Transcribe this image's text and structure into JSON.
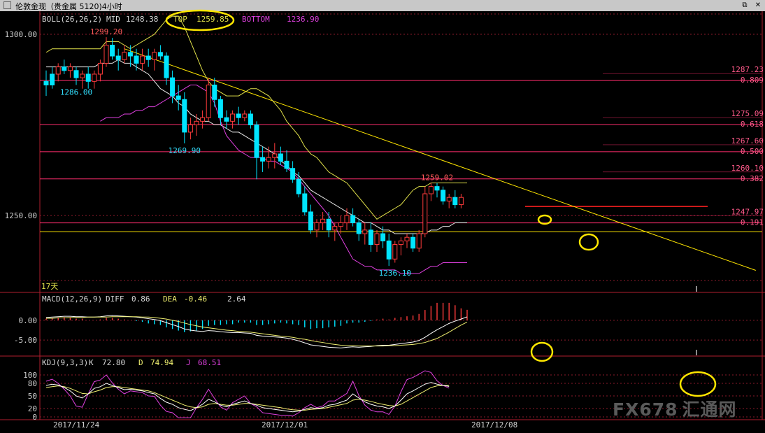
{
  "window": {
    "title": "伦敦金现（贵金属 5120)4小时"
  },
  "watermark": {
    "brand": "FX678",
    "cn": "汇通网"
  },
  "colors": {
    "bg": "#000000",
    "up": "#ff3b3b",
    "down": "#00e5ff",
    "mid": "#e8e8e8",
    "top": "#e0e04a",
    "bottom": "#e040e0",
    "hline": "#ff2e6e",
    "yellow": "#ffe600",
    "dea": "#f0f070",
    "diff": "#ffffff",
    "k": "#ffffff",
    "d": "#f0f070",
    "j": "#e040e0",
    "grid": "#8a1a2a"
  },
  "chart_data": [
    {
      "type": "candlestick",
      "indicator": {
        "name": "BOLL(26,26,2)",
        "mid_label": "MID",
        "mid": "1248.38",
        "top_label": "TOP",
        "top": "1259.85",
        "bottom_label": "BOTTOM",
        "bottom": "1236.90"
      },
      "y_ticks": [
        "1300.00",
        "1250.00"
      ],
      "ylim": [
        1231.5,
        1302.5
      ],
      "x_ticks": [
        "2017/11/24",
        "2017/12/01",
        "2017/12/08"
      ],
      "period_label": "17天",
      "annotations": [
        {
          "text": "1299.20",
          "i": 10,
          "price": 1299.2,
          "color": "up"
        },
        {
          "text": "1286.00",
          "i": 5,
          "price": 1286.0,
          "color": "down"
        },
        {
          "text": "1269.90",
          "i": 23,
          "price": 1269.9,
          "color": "down"
        },
        {
          "text": "1236.10",
          "i": 58,
          "price": 1236.1,
          "color": "down"
        },
        {
          "text": "1259.02",
          "i": 65,
          "price": 1259.02,
          "color": "up"
        }
      ],
      "fib_levels": [
        {
          "price": "1287.23",
          "ratio": "0.809"
        },
        {
          "price": "1275.09",
          "ratio": "0.618"
        },
        {
          "price": "1267.60",
          "ratio": "0.500"
        },
        {
          "price": "1260.10",
          "ratio": "0.382"
        },
        {
          "price": "1247.97",
          "ratio": "0.191"
        }
      ],
      "candles": [
        [
          1287,
          1290,
          1283,
          1286
        ],
        [
          1289,
          1291,
          1285,
          1286
        ],
        [
          1289,
          1292,
          1287,
          1291
        ],
        [
          1291,
          1293,
          1289,
          1290
        ],
        [
          1290,
          1292,
          1288,
          1291
        ],
        [
          1290,
          1291,
          1286,
          1288
        ],
        [
          1288,
          1290,
          1285,
          1289
        ],
        [
          1289,
          1291,
          1285,
          1287
        ],
        [
          1287,
          1290,
          1285,
          1289
        ],
        [
          1289,
          1293,
          1287,
          1292
        ],
        [
          1292,
          1299.2,
          1291,
          1297
        ],
        [
          1297,
          1299,
          1293,
          1294
        ],
        [
          1294,
          1296,
          1290,
          1293
        ],
        [
          1293,
          1297,
          1292,
          1295
        ],
        [
          1295,
          1297,
          1291,
          1294
        ],
        [
          1294,
          1296,
          1290,
          1292
        ],
        [
          1292,
          1296,
          1290,
          1294
        ],
        [
          1294,
          1296,
          1291,
          1293
        ],
        [
          1293,
          1296,
          1290,
          1295
        ],
        [
          1295,
          1297,
          1293,
          1294
        ],
        [
          1294,
          1295,
          1286,
          1288
        ],
        [
          1288,
          1290,
          1281,
          1283
        ],
        [
          1283,
          1286,
          1279,
          1282
        ],
        [
          1282,
          1284,
          1269.9,
          1273
        ],
        [
          1273,
          1277,
          1271,
          1275
        ],
        [
          1275,
          1278,
          1272,
          1276
        ],
        [
          1276,
          1279,
          1274,
          1277
        ],
        [
          1277,
          1288,
          1276,
          1286
        ],
        [
          1286,
          1288,
          1280,
          1282
        ],
        [
          1282,
          1283,
          1275,
          1277
        ],
        [
          1277,
          1279,
          1274,
          1276
        ],
        [
          1276,
          1279,
          1274,
          1278
        ],
        [
          1278,
          1280,
          1275,
          1277
        ],
        [
          1277,
          1279,
          1276,
          1278
        ],
        [
          1278,
          1279,
          1274,
          1275
        ],
        [
          1275,
          1276,
          1260,
          1266
        ],
        [
          1266,
          1269,
          1262,
          1265
        ],
        [
          1265,
          1269,
          1263,
          1266
        ],
        [
          1266,
          1270,
          1263,
          1267
        ],
        [
          1267,
          1269,
          1264,
          1265
        ],
        [
          1265,
          1268,
          1262,
          1263
        ],
        [
          1263,
          1265,
          1259,
          1260
        ],
        [
          1260,
          1262,
          1255,
          1256
        ],
        [
          1256,
          1258,
          1250,
          1251
        ],
        [
          1251,
          1253,
          1245,
          1246
        ],
        [
          1246,
          1249,
          1244,
          1248
        ],
        [
          1248,
          1251,
          1246,
          1249
        ],
        [
          1249,
          1251,
          1244,
          1246
        ],
        [
          1246,
          1248,
          1243,
          1247
        ],
        [
          1247,
          1250,
          1245,
          1248
        ],
        [
          1248,
          1252,
          1246,
          1250
        ],
        [
          1250,
          1252,
          1247,
          1248
        ],
        [
          1248,
          1249,
          1243,
          1245
        ],
        [
          1245,
          1248,
          1242,
          1246
        ],
        [
          1246,
          1248,
          1240,
          1242
        ],
        [
          1242,
          1246,
          1240,
          1245
        ],
        [
          1245,
          1247,
          1241,
          1243
        ],
        [
          1243,
          1245,
          1236.1,
          1238
        ],
        [
          1238,
          1243,
          1237,
          1242
        ],
        [
          1242,
          1244,
          1239,
          1243
        ],
        [
          1243,
          1245,
          1241,
          1244
        ],
        [
          1244,
          1245,
          1240,
          1241
        ],
        [
          1241,
          1246,
          1240,
          1245
        ],
        [
          1245,
          1258,
          1244,
          1256
        ],
        [
          1256,
          1259.02,
          1254,
          1258
        ],
        [
          1258,
          1259,
          1255,
          1257
        ],
        [
          1257,
          1258,
          1253,
          1254
        ],
        [
          1254,
          1256,
          1252,
          1255
        ],
        [
          1255,
          1257,
          1252,
          1253
        ],
        [
          1253,
          1256,
          1252,
          1255
        ]
      ],
      "mid": [
        1291,
        1291,
        1291,
        1291,
        1291,
        1291,
        1291,
        1291,
        1291,
        1292,
        1292,
        1292,
        1293,
        1292,
        1292,
        1291,
        1290,
        1289,
        1287,
        1285,
        1284,
        1283,
        1281,
        1280,
        1278,
        1277,
        1276,
        1276,
        1275,
        1275,
        1274,
        1273,
        1273,
        1272,
        1271,
        1270,
        1269,
        1268,
        1267,
        1265,
        1264,
        1262,
        1261,
        1259,
        1257,
        1256,
        1255,
        1254,
        1253,
        1252,
        1251,
        1250,
        1249,
        1248,
        1248,
        1247,
        1246,
        1246,
        1245,
        1245,
        1245,
        1245,
        1245,
        1245,
        1246,
        1246,
        1247,
        1247,
        1248,
        1248,
        1248
      ],
      "top": [
        1295,
        1296,
        1296,
        1296,
        1296,
        1296,
        1296,
        1296,
        1296,
        1296,
        1298,
        1298,
        1298,
        1297,
        1296,
        1297,
        1298,
        1299,
        1300,
        1302,
        1304,
        1305,
        1305,
        1302,
        1298,
        1294,
        1290,
        1287,
        1285,
        1284,
        1283,
        1283,
        1283,
        1284,
        1285,
        1285,
        1284,
        1283,
        1281,
        1279,
        1276,
        1274,
        1272,
        1269,
        1267,
        1266,
        1264,
        1262,
        1261,
        1260,
        1259,
        1257,
        1255,
        1253,
        1251,
        1249,
        1250,
        1251,
        1252,
        1253,
        1255,
        1257,
        1258,
        1258,
        1259,
        1259,
        1259,
        1259,
        1259,
        1259,
        1259
      ],
      "bottom": [
        1276,
        1277,
        1277,
        1277,
        1278,
        1278,
        1279,
        1279,
        1280,
        1280,
        1281,
        1282,
        1283,
        1284,
        1285,
        1286,
        1286,
        1285,
        1284,
        1281,
        1276,
        1272,
        1270,
        1268,
        1267,
        1266,
        1266,
        1266,
        1265,
        1265,
        1264,
        1263,
        1262,
        1260,
        1258,
        1256,
        1254,
        1252,
        1250,
        1247,
        1244,
        1241,
        1238,
        1237,
        1236,
        1236,
        1235,
        1235,
        1235,
        1235,
        1234,
        1234,
        1234,
        1234,
        1235,
        1236,
        1236,
        1237,
        1237,
        1237,
        1237,
        1237
      ],
      "bottom_start": 9,
      "trendline": {
        "from": [
          13,
          1296
        ],
        "to": [
          80,
          1257
        ]
      },
      "support_line": 1245.5,
      "resistance_line": 1252.5
    },
    {
      "type": "bar",
      "indicator": {
        "name": "MACD(12,26,9)",
        "diff_label": "DIFF",
        "diff": "0.86",
        "dea_label": "DEA",
        "dea": "-0.46",
        "macd": "2.64"
      },
      "y_ticks": [
        "0.00",
        "-5.00"
      ],
      "ylim": [
        -8.5,
        3.5
      ],
      "diff": [
        0.7,
        0.8,
        0.9,
        1.0,
        1.0,
        0.9,
        0.9,
        0.8,
        0.8,
        0.9,
        1.1,
        1.2,
        1.1,
        1.0,
        0.9,
        0.8,
        0.6,
        0.4,
        0.2,
        -0.1,
        -0.6,
        -1.1,
        -1.6,
        -2.2,
        -2.5,
        -2.7,
        -2.8,
        -2.6,
        -2.7,
        -2.9,
        -3.0,
        -3.1,
        -3.1,
        -3.2,
        -3.3,
        -3.8,
        -4.0,
        -4.1,
        -4.2,
        -4.3,
        -4.5,
        -4.8,
        -5.2,
        -5.7,
        -6.2,
        -6.4,
        -6.6,
        -6.8,
        -6.9,
        -7.0,
        -6.8,
        -6.7,
        -6.8,
        -6.7,
        -6.6,
        -6.4,
        -6.3,
        -6.3,
        -6.1,
        -5.9,
        -5.7,
        -5.5,
        -5.1,
        -4.3,
        -3.3,
        -2.4,
        -1.6,
        -0.8,
        -0.2,
        0.3,
        0.86
      ],
      "dea": [
        0.5,
        0.5,
        0.6,
        0.6,
        0.7,
        0.7,
        0.7,
        0.8,
        0.8,
        0.8,
        0.8,
        0.9,
        0.9,
        0.9,
        0.9,
        0.9,
        0.8,
        0.8,
        0.7,
        0.5,
        0.3,
        0.0,
        -0.3,
        -0.7,
        -1.1,
        -1.4,
        -1.7,
        -1.9,
        -2.1,
        -2.3,
        -2.5,
        -2.6,
        -2.8,
        -2.9,
        -3.0,
        -3.2,
        -3.4,
        -3.6,
        -3.8,
        -4.0,
        -4.1,
        -4.3,
        -4.6,
        -4.8,
        -5.1,
        -5.4,
        -5.6,
        -5.9,
        -6.1,
        -6.3,
        -6.4,
        -6.4,
        -6.5,
        -6.5,
        -6.5,
        -6.5,
        -6.5,
        -6.4,
        -6.4,
        -6.3,
        -6.2,
        -6.1,
        -5.9,
        -5.6,
        -5.1,
        -4.6,
        -3.8,
        -3.0,
        -2.1,
        -1.2,
        -0.46
      ]
    },
    {
      "type": "line",
      "indicator": {
        "name": "KDJ(9,3,3)",
        "k_label": "K",
        "k": "72.80",
        "d_label": "D",
        "d": "74.94",
        "j_label": "J",
        "j": "68.51"
      },
      "y_ticks": [
        "100",
        "80",
        "50",
        "20",
        "0"
      ],
      "ylim": [
        0,
        110
      ],
      "k": [
        75,
        78,
        76,
        70,
        62,
        50,
        45,
        55,
        68,
        72,
        80,
        75,
        70,
        65,
        66,
        64,
        62,
        58,
        55,
        44,
        35,
        30,
        22,
        18,
        15,
        22,
        30,
        42,
        36,
        28,
        24,
        30,
        34,
        38,
        32,
        28,
        22,
        20,
        18,
        16,
        14,
        12,
        14,
        18,
        22,
        20,
        22,
        28,
        30,
        35,
        40,
        55,
        45,
        36,
        30,
        26,
        24,
        20,
        26,
        40,
        55,
        62,
        70,
        78,
        82,
        78,
        75,
        72.8
      ],
      "d": [
        70,
        72,
        74,
        72,
        68,
        62,
        56,
        55,
        60,
        64,
        70,
        72,
        72,
        70,
        68,
        66,
        64,
        62,
        58,
        52,
        46,
        40,
        34,
        28,
        24,
        22,
        24,
        30,
        32,
        30,
        28,
        28,
        30,
        32,
        32,
        30,
        28,
        26,
        24,
        22,
        19,
        17,
        16,
        16,
        18,
        19,
        20,
        23,
        26,
        29,
        32,
        40,
        42,
        40,
        37,
        33,
        30,
        27,
        26,
        30,
        38,
        46,
        54,
        62,
        70,
        74,
        75,
        74.94
      ],
      "j": [
        85,
        90,
        80,
        66,
        50,
        26,
        23,
        55,
        84,
        88,
        100,
        81,
        66,
        55,
        62,
        60,
        58,
        50,
        49,
        28,
        13,
        10,
        -2,
        -2,
        -3,
        22,
        42,
        66,
        44,
        24,
        16,
        34,
        42,
        50,
        32,
        24,
        10,
        8,
        6,
        4,
        4,
        2,
        10,
        22,
        30,
        22,
        26,
        38,
        38,
        47,
        56,
        85,
        51,
        28,
        16,
        12,
        12,
        6,
        26,
        60,
        89,
        94,
        102,
        110,
        106,
        86,
        75,
        68.51
      ]
    }
  ]
}
